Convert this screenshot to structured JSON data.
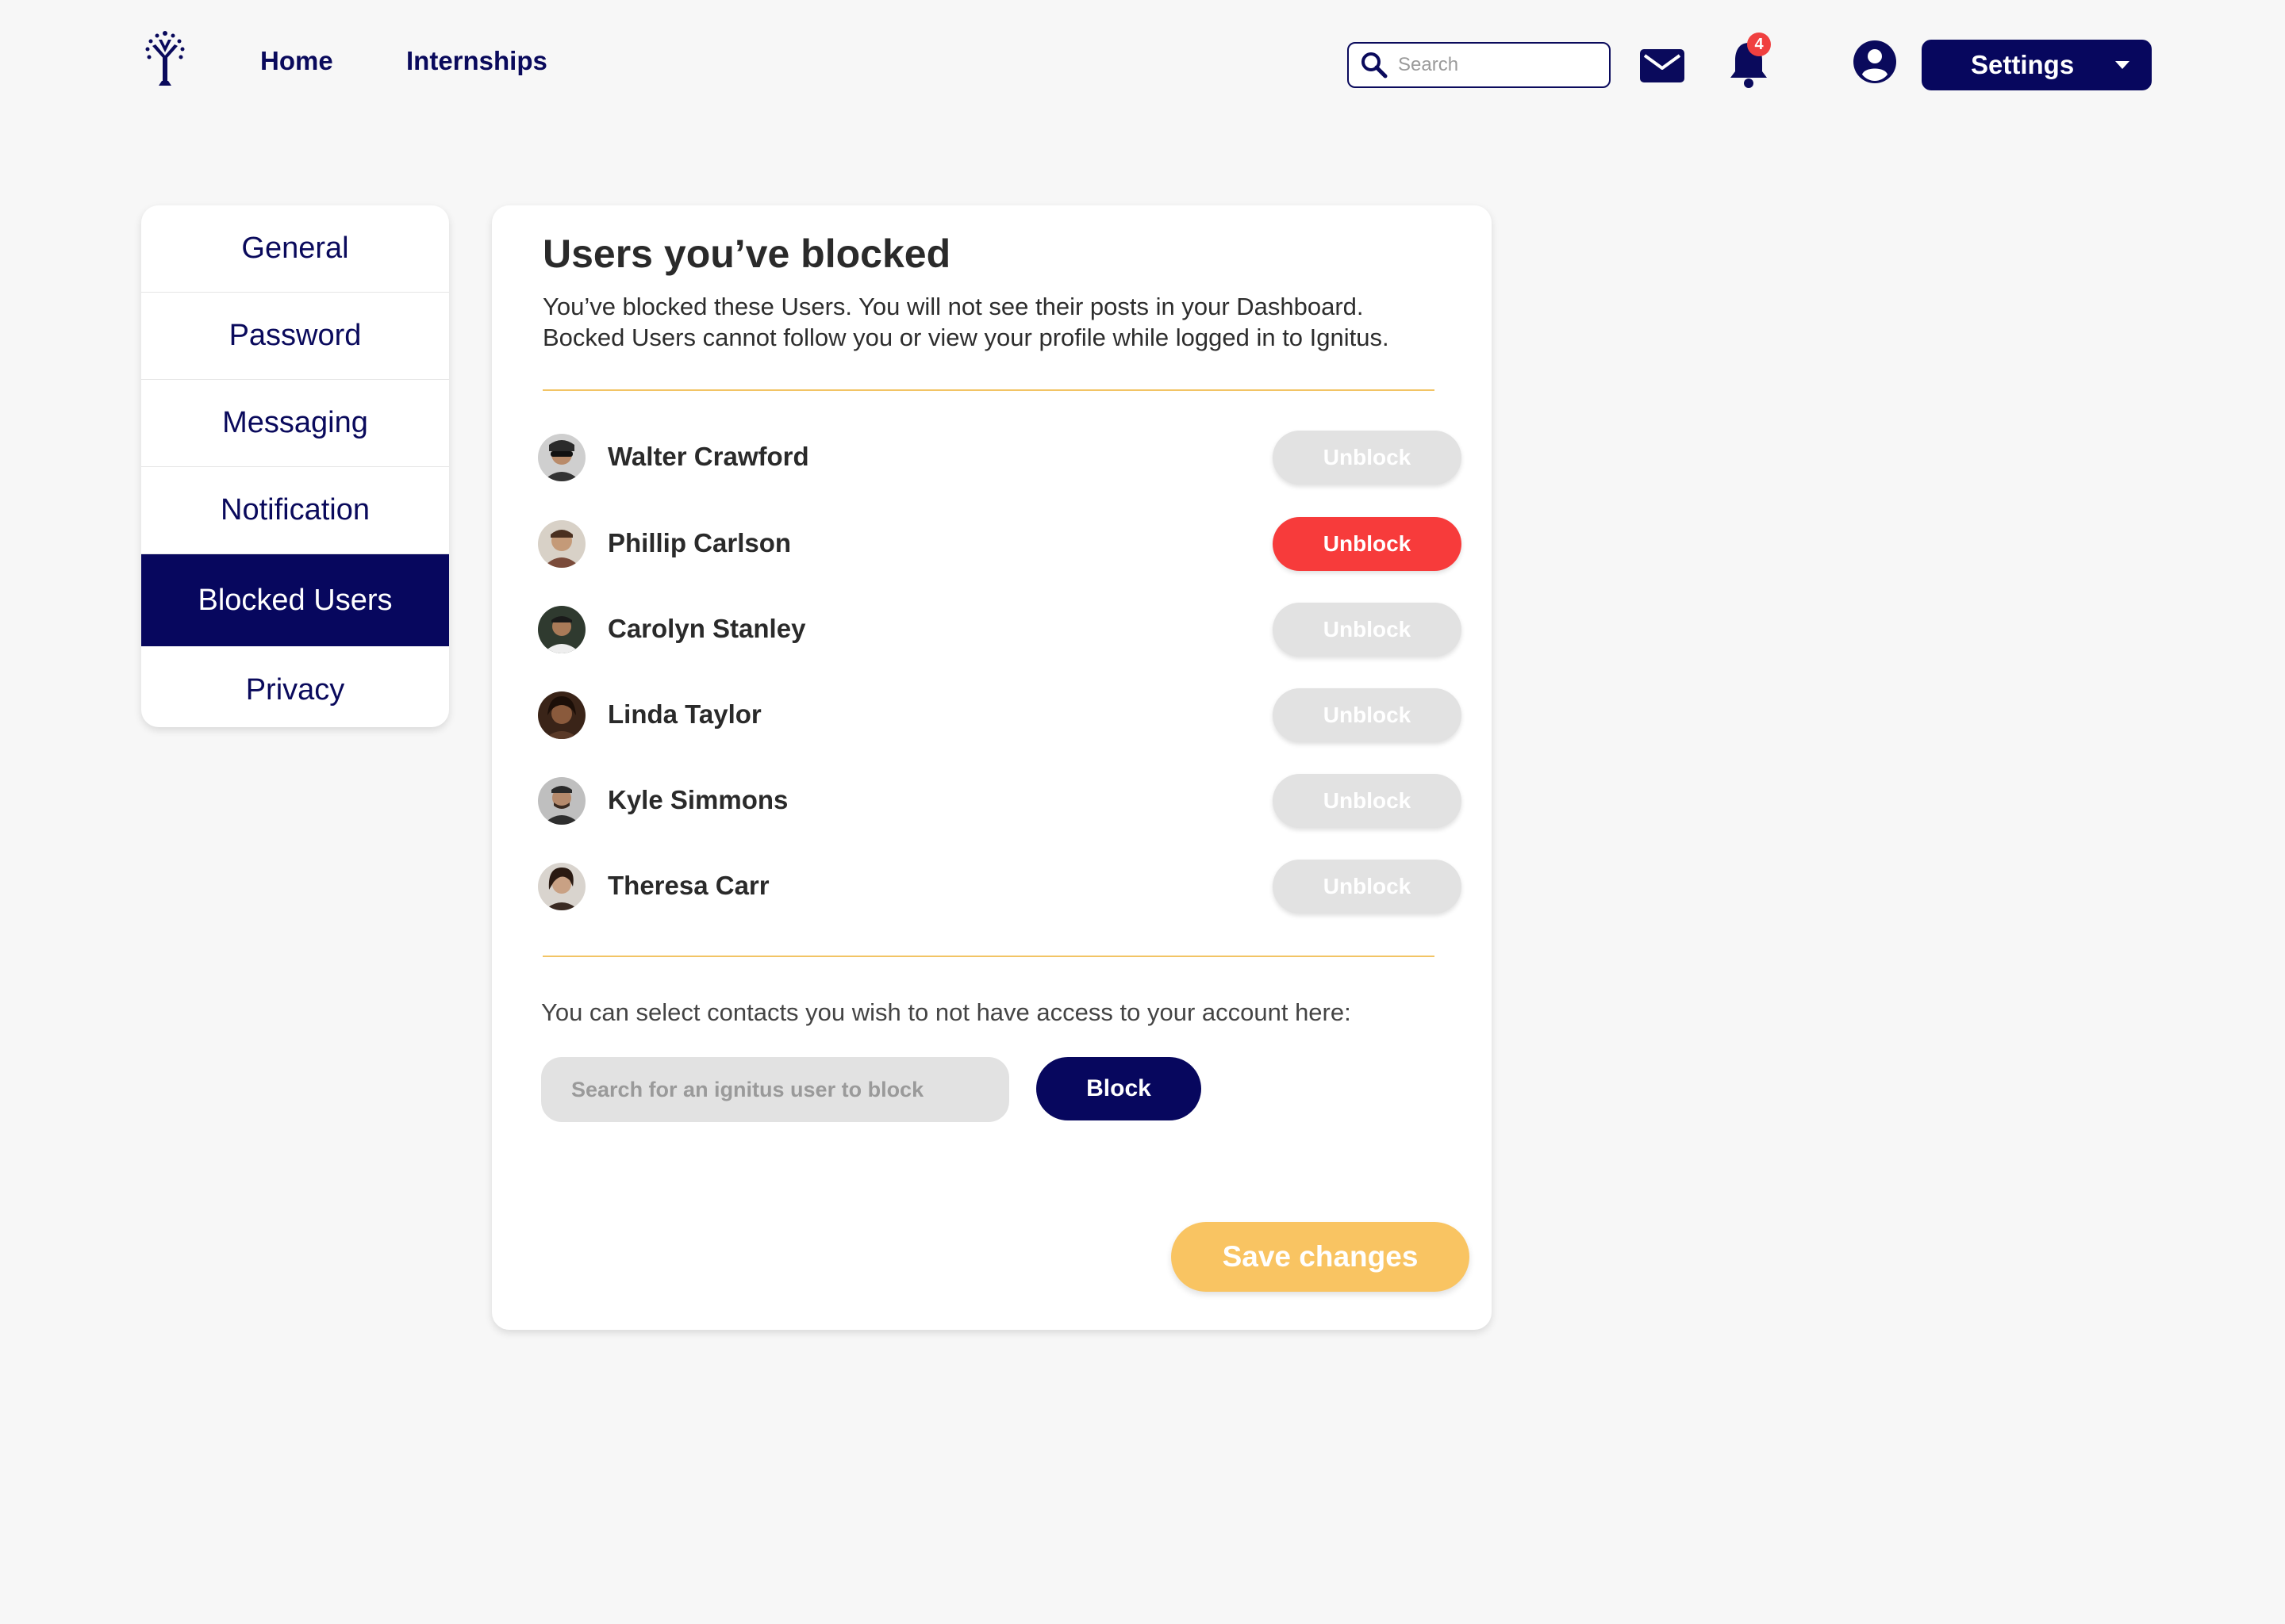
{
  "nav": {
    "home": "Home",
    "internships": "Internships",
    "search_placeholder": "Search",
    "notification_count": "4",
    "settings_label": "Settings"
  },
  "sidebar": {
    "items": [
      {
        "label": "General"
      },
      {
        "label": "Password"
      },
      {
        "label": "Messaging"
      },
      {
        "label": "Notification"
      },
      {
        "label": "Blocked Users",
        "active": true
      },
      {
        "label": "Privacy"
      }
    ]
  },
  "main": {
    "title": "Users you’ve blocked",
    "description_line1": "You’ve blocked these Users. You will not see their posts in your Dashboard.",
    "description_line2": "Bocked Users cannot follow you or view your profile while logged in to Ignitus.",
    "blocked_users": [
      {
        "name": "Walter Crawford",
        "button": "Unblock",
        "active": false
      },
      {
        "name": "Phillip Carlson",
        "button": "Unblock",
        "active": true
      },
      {
        "name": "Carolyn Stanley",
        "button": "Unblock",
        "active": false
      },
      {
        "name": "Linda Taylor",
        "button": "Unblock",
        "active": false
      },
      {
        "name": "Kyle Simmons",
        "button": "Unblock",
        "active": false
      },
      {
        "name": "Theresa Carr",
        "button": "Unblock",
        "active": false
      }
    ],
    "select_hint": "You can select contacts you wish to not have access to your account here:",
    "block_search_placeholder": "Search for an ignitus user to block",
    "block_button": "Block",
    "save_button": "Save changes"
  },
  "colors": {
    "primary": "#07075e",
    "accent": "#f9c462",
    "danger": "#f73b3b",
    "disabled": "#e2e2e2",
    "divider": "#f2c465"
  }
}
